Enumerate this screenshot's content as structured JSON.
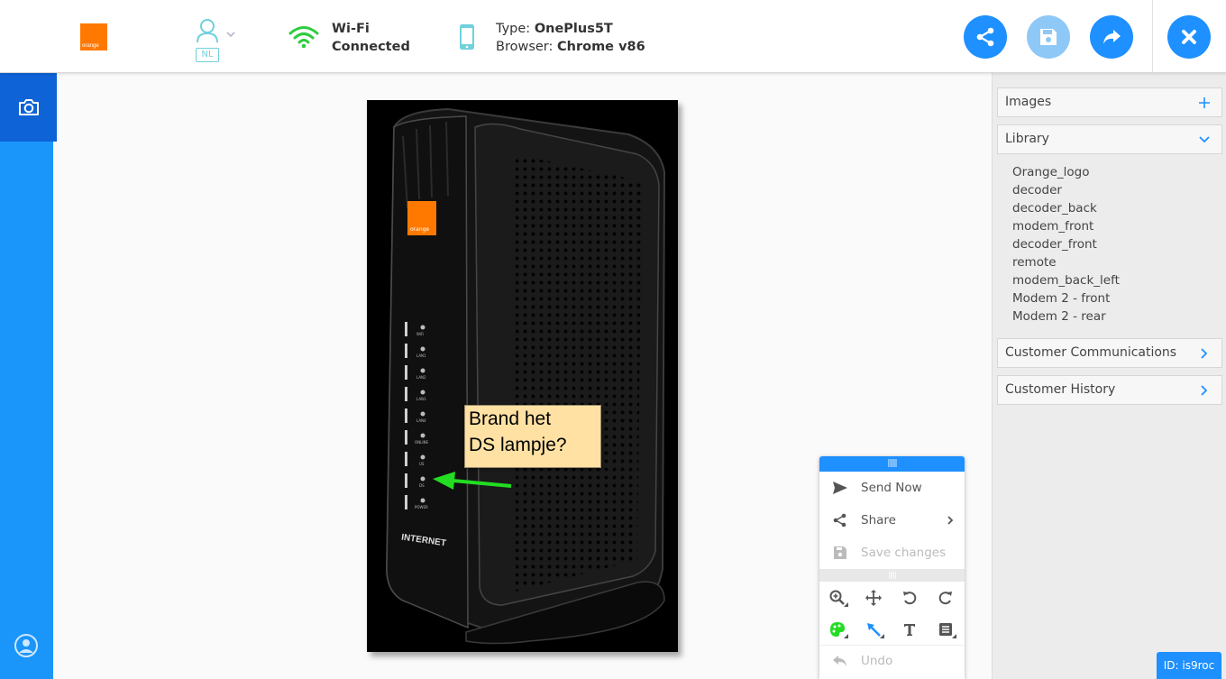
{
  "header": {
    "brand_text": "orange",
    "language": "NL",
    "wifi": {
      "label": "Wi-Fi",
      "status": "Connected"
    },
    "device": {
      "type_label": "Type:",
      "type_value": "OnePlus5T",
      "browser_label": "Browser:",
      "browser_value": "Chrome v86"
    },
    "buttons": [
      "share-icon",
      "save-icon",
      "forward-icon",
      "close-icon"
    ]
  },
  "canvas": {
    "device_labels": {
      "brand": "orange",
      "internet": "INTERNET"
    },
    "led_labels": [
      "WiFi",
      "LAN1",
      "LAN2",
      "LAN3",
      "LAN4",
      "ONLINE",
      "US",
      "DS",
      "POWER"
    ],
    "callout": {
      "line1": "Brand het",
      "line2": "DS lampje?"
    },
    "arrow_color": "#22dd22"
  },
  "toolbar": {
    "send_now": "Send Now",
    "share": "Share",
    "save_changes": "Save changes",
    "undo": "Undo",
    "tools": [
      "zoom-icon",
      "move-icon",
      "rotate-left-icon",
      "rotate-right-icon",
      "palette-icon",
      "arrow-icon",
      "text-icon",
      "note-icon"
    ]
  },
  "sidebar": {
    "images": "Images",
    "library": "Library",
    "library_items": [
      "Orange_logo",
      "decoder",
      "decoder_back",
      "modem_front",
      "decoder_front",
      "remote",
      "modem_back_left",
      "Modem 2 - front",
      "Modem 2 - rear"
    ],
    "customer_communications": "Customer Communications",
    "customer_history": "Customer History"
  },
  "session": {
    "id": "ID: is9roc"
  },
  "colors": {
    "accent": "#1e90ff",
    "sidebar": "#1a96fb",
    "brand": "#ff7900",
    "wifi": "#2ecc40"
  }
}
